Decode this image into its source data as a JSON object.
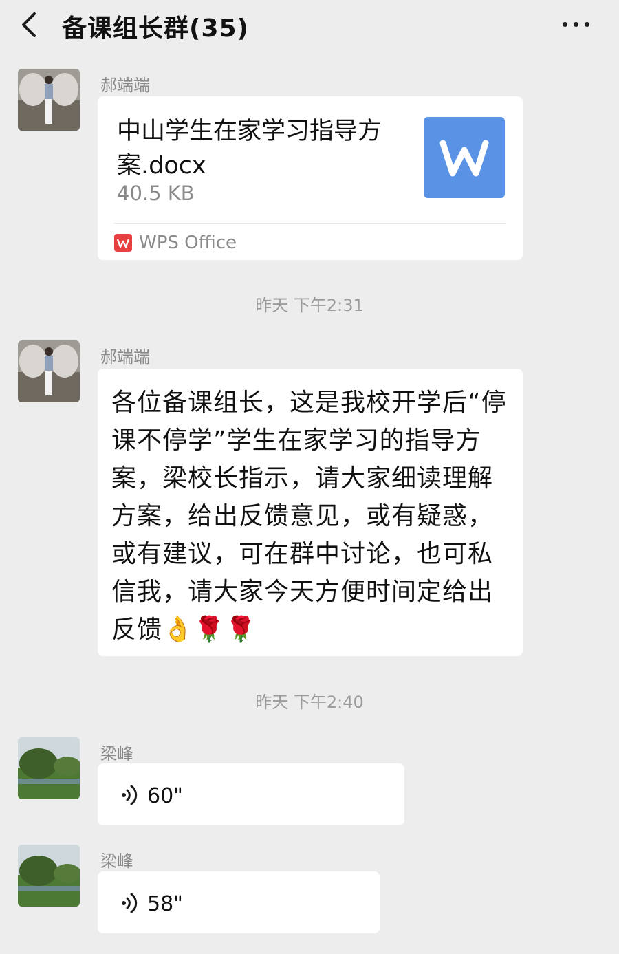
{
  "header": {
    "title": "备课组长群(35)"
  },
  "messages": {
    "file_msg": {
      "sender": "郝端端",
      "file_name": "中山学生在家学习指导方案.docx",
      "file_size": "40.5 KB",
      "app_label": "WPS  Office"
    },
    "time1": "昨天 下午2:31",
    "text_msg": {
      "sender": "郝端端",
      "text": "各位备课组长，这是我校开学后“停课不停学”学生在家学习的指导方案，梁校长指示，请大家细读理解方案，给出反馈意见，或有疑惑，或有建议，可在群中讨论，也可私信我，请大家今天方便时间定给出反馈👌🌹🌹"
    },
    "time2": "昨天 下午2:40",
    "voice_msg_1": {
      "sender": "梁峰",
      "duration": "60\""
    },
    "voice_msg_2": {
      "sender": "梁峰",
      "duration": "58\""
    }
  },
  "colors": {
    "background": "#ededed",
    "bubble": "#ffffff",
    "word_icon": "#5a93e6",
    "wps_icon": "#e5403f"
  }
}
